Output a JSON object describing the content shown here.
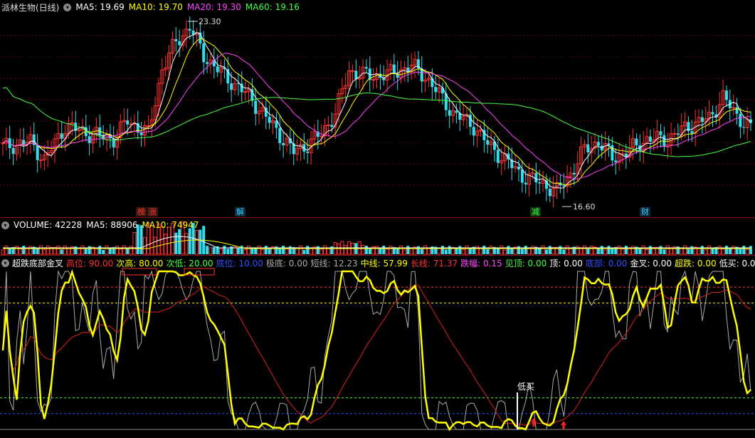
{
  "price": {
    "title": "派林生物(日线)",
    "ma": [
      {
        "label": "MA5: 19.69",
        "color": "#ffffff"
      },
      {
        "label": "MA10: 19.70",
        "color": "#ffff00"
      },
      {
        "label": "MA20: 19.30",
        "color": "#ff44ff"
      },
      {
        "label": "MA60: 19.16",
        "color": "#44ff44"
      }
    ],
    "high_label": "23.30",
    "low_label": "16.60",
    "tags": [
      {
        "text": "榜",
        "color": "#ff3030"
      },
      {
        "text": "涨",
        "color": "#ff3030"
      },
      {
        "text": "解",
        "color": "#33ccff"
      },
      {
        "text": "减",
        "color": "#44ff44"
      },
      {
        "text": "财",
        "color": "#33ccff"
      }
    ]
  },
  "volume": {
    "labels": [
      {
        "label": "VOLUME: 42228",
        "color": "#ffffff"
      },
      {
        "label": "MA5: 88906",
        "color": "#ffffff"
      },
      {
        "label": "MA10: 74947",
        "color": "#ffff00"
      }
    ]
  },
  "indicator": {
    "title": "超跌底部金叉",
    "items": [
      {
        "label": "高位: 90.00",
        "color": "#ff3030"
      },
      {
        "label": "次高: 80.00",
        "color": "#ffff00"
      },
      {
        "label": "次低: 20.00",
        "color": "#44ff44"
      },
      {
        "label": "底位: 10.00",
        "color": "#3050ff"
      },
      {
        "label": "极底: 0.00",
        "color": "#aaaaaa"
      },
      {
        "label": "短线: 12.23",
        "color": "#aaaaaa"
      },
      {
        "label": "中线: 57.99",
        "color": "#ffff00"
      },
      {
        "label": "长线: 71.37",
        "color": "#ff3030"
      },
      {
        "label": "跌幅: 0.15",
        "color": "#ff44ff"
      },
      {
        "label": "见顶: 0.00",
        "color": "#44ff44"
      },
      {
        "label": "顶: 0.00",
        "color": "#ffffff"
      },
      {
        "label": "底部: 0.00",
        "color": "#3050ff"
      },
      {
        "label": "金叉: 0.00",
        "color": "#ffffff"
      },
      {
        "label": "超跌: 0.00",
        "color": "#ffff00"
      },
      {
        "label": "低买: 0.00",
        "color": "#ffffff"
      }
    ],
    "buy_label": "低买"
  }
}
